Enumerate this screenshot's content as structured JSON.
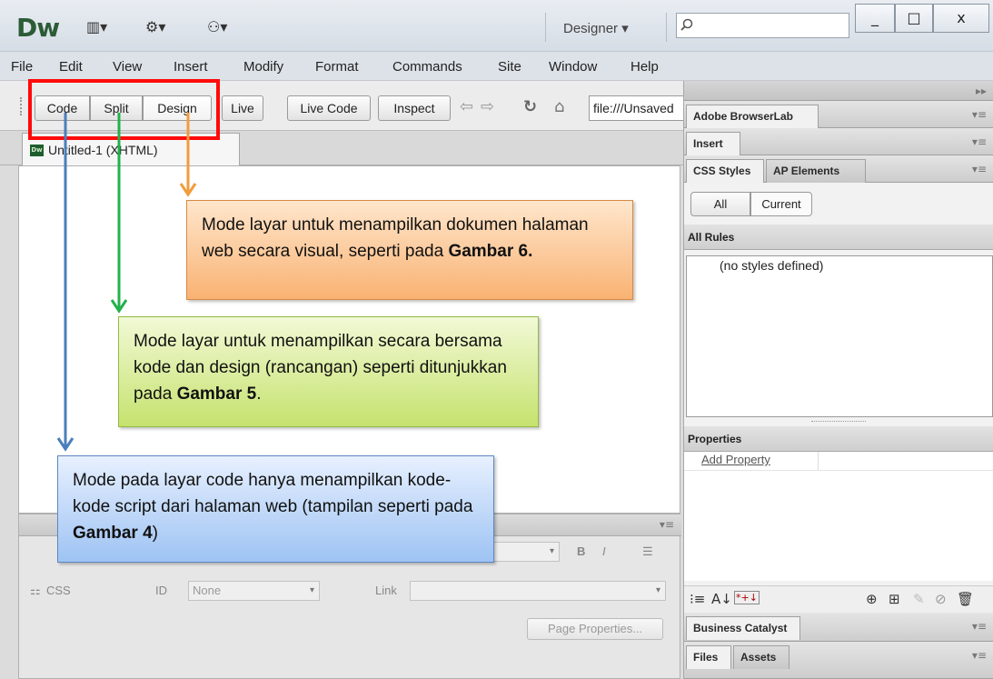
{
  "titlebar": {
    "logo": "Dw",
    "layout_icon": "▥▾",
    "settings_icon": "⚙▾",
    "sitemap_icon": "⚇▾",
    "workspace": "Designer ▾",
    "window_controls": [
      "_",
      "□",
      "x"
    ]
  },
  "menubar": {
    "items": [
      "File",
      "Edit",
      "View",
      "Insert",
      "Modify",
      "Format",
      "Commands",
      "Site",
      "Window",
      "Help"
    ]
  },
  "toolbar": {
    "code": "Code",
    "split": "Split",
    "design": "Design",
    "live": "Live",
    "live_code": "Live Code",
    "inspect": "Inspect",
    "url": "file:///Unsaved"
  },
  "document": {
    "tab_icon": "Dw",
    "tab_label": "Untitled-1 (XHTML)"
  },
  "property_inspector": {
    "css_label": "CSS",
    "id_label": "ID",
    "id_value": "None",
    "link_label": "Link",
    "page_properties": "Page Properties..."
  },
  "right_panels": {
    "browserlab": "Adobe BrowserLab",
    "insert": "Insert",
    "css_styles_tab": "CSS Styles",
    "ap_elements_tab": "AP Elements",
    "all_button": "All",
    "current_button": "Current",
    "all_rules": "All Rules",
    "no_styles": "(no styles defined)",
    "properties": "Properties",
    "add_property": "Add Property",
    "business_catalyst": "Business Catalyst",
    "files_tab": "Files",
    "assets_tab": "Assets"
  },
  "callouts": {
    "design_text": "Mode layar untuk menampilkan dokumen halaman web secara visual, seperti pada",
    "design_ref": "Gambar 6.",
    "split_text": "Mode layar untuk menampilkan secara bersama kode dan design (rancangan) seperti ditunjukkan pada",
    "split_ref": "Gambar 5",
    "split_end": ".",
    "code_text": "Mode pada layar code hanya menampilkan kode-kode script dari halaman web (tampilan seperti pada",
    "code_ref": "Gambar 4",
    "code_end": ")"
  },
  "colors": {
    "red_box": "#ff0a0a",
    "arrow_blue": "#4a7ebb",
    "arrow_green": "#22b14c",
    "arrow_orange": "#f29c3c"
  }
}
